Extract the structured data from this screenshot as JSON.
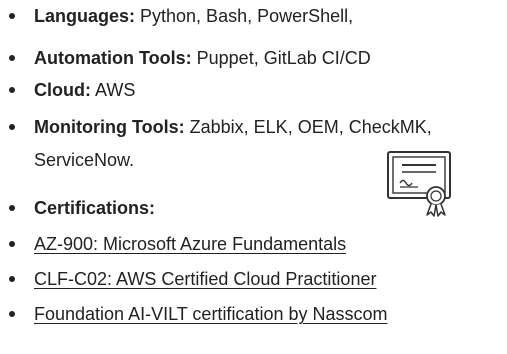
{
  "skills": [
    {
      "label": "Languages:",
      "value": " Python, Bash, PowerShell,"
    },
    {
      "label": "Automation Tools:",
      "value": " Puppet, GitLab CI/CD"
    },
    {
      "label": "Cloud:",
      "value": " AWS"
    },
    {
      "label": "Monitoring Tools:",
      "value": " Zabbix, ELK, OEM, CheckMK,",
      "continuation": "ServiceNow."
    }
  ],
  "certifications": {
    "heading": "Certifications:",
    "icon": "certificate-icon",
    "items": [
      "AZ-900: Microsoft Azure Fundamentals",
      "CLF-C02: AWS Certified Cloud Practitioner",
      "Foundation AI-VILT certification by Nasscom"
    ]
  }
}
